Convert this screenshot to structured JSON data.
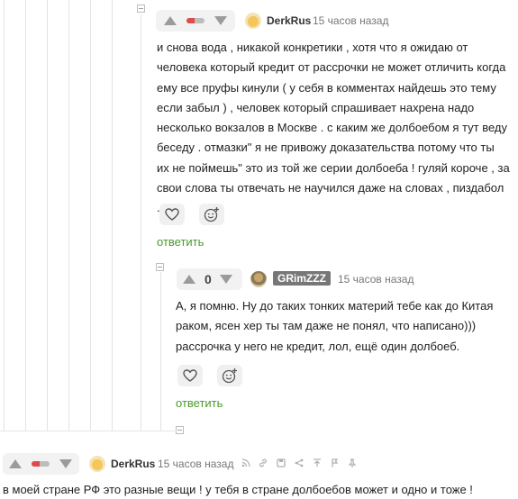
{
  "comments": [
    {
      "author": "DerkRus",
      "time": "15 часов назад",
      "rating_fill": 0.45,
      "body": "и снова вода , никакой конкретики , хотя что я ожидаю от человека который кредит от рассрочки не может отличить когда ему все пруфы кинули ( у себя в комментах найдешь это тему если забыл ) , человек который спрашивает нахрена надо несколько вокзалов в Москве . с каким же долбоебом я тут веду беседу . отмазки\" я не привожу доказательства потому что ты их не поймешь\" это из той же серии долбоеба ! гуляй короче , за свои слова ты отвечать не научился даже на словах , пиздабол .",
      "reply_label": "ответить",
      "avatar_icon": "sun-avatar-icon"
    },
    {
      "author": "GRimZZZ",
      "time": "15 часов назад",
      "rating": "0",
      "body": "А, я помню. Ну до таких тонких материй тебе как до Китая раком, ясен хер ты там даже не понял, что написано))) рассрочка у него не кредит, лол, ещё один долбоеб.",
      "reply_label": "ответить",
      "avatar_icon": "portrait-avatar-icon"
    },
    {
      "author": "DerkRus",
      "time": "15 часов назад",
      "rating_fill": 0.45,
      "body": "в моей стране РФ это разные вещи ! у тебя в стране долбоебов может и одно и тоже !",
      "avatar_icon": "sun-avatar-icon"
    }
  ],
  "colors": {
    "accent_reply": "#4a9b2b",
    "rating_negative": "#e04a4a",
    "nick_badge_bg": "#777777"
  },
  "icons": {
    "upvote": "arrow-up-icon",
    "downvote": "arrow-down-icon",
    "like": "heart-icon",
    "emoji": "add-emoji-icon",
    "collapse": "collapse-icon",
    "tools": [
      "network-icon",
      "link-icon",
      "save-icon",
      "share-icon",
      "jump-to-top-icon",
      "bookmark-flag-icon",
      "pin-icon"
    ]
  }
}
